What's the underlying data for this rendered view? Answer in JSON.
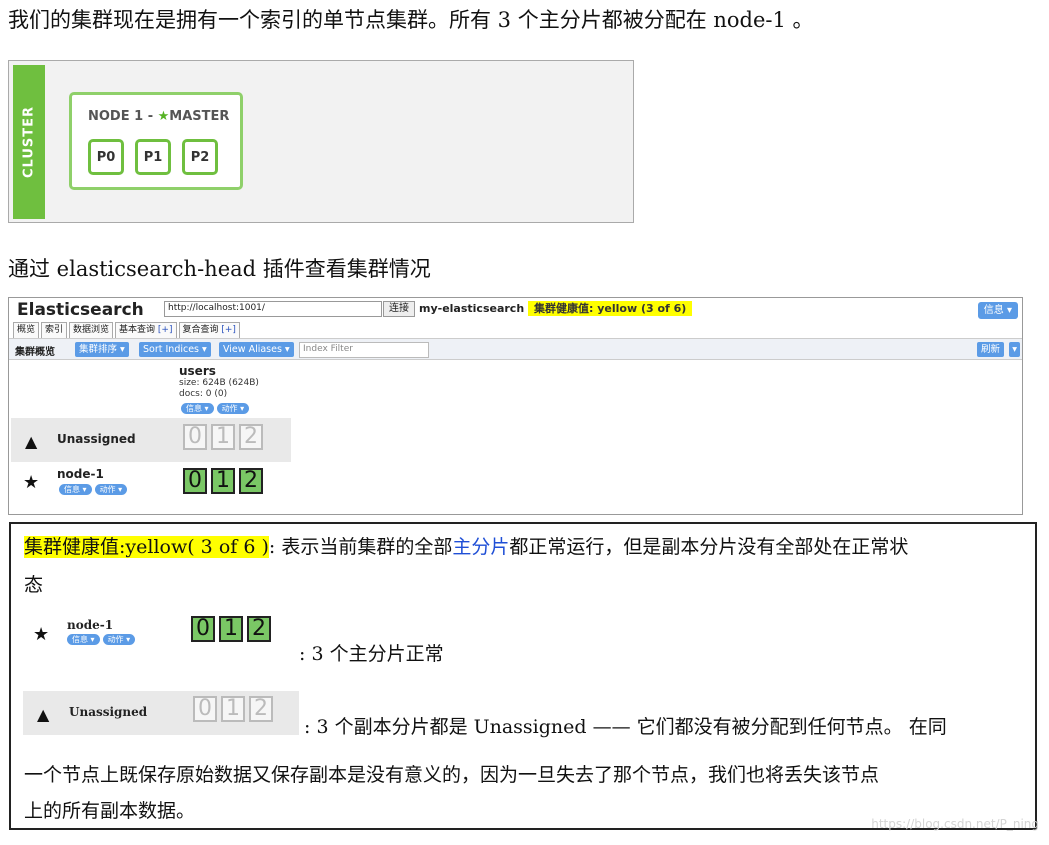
{
  "paragraphs": {
    "intro": "我们的集群现在是拥有一个索引的单节点集群。所有 3 个主分片都被分配在  node-1  。",
    "head_plugin": "通过 elasticsearch-head 插件查看集群情况"
  },
  "cluster_diagram": {
    "cluster_label": "CLUSTER",
    "node_title": "NODE 1 - ",
    "master_label": "MASTER",
    "shards": [
      "P0",
      "P1",
      "P2"
    ]
  },
  "es_head": {
    "logo": "Elasticsearch",
    "url": "http://localhost:1001/",
    "connect_label": "连接",
    "cluster_name": "my-elasticsearch",
    "health_text": "集群健康值: yellow (3 of 6)",
    "info_button": "信息 ▾",
    "tabs": [
      {
        "label": "概览",
        "plus": ""
      },
      {
        "label": "索引",
        "plus": ""
      },
      {
        "label": "数据浏览",
        "plus": ""
      },
      {
        "label": "基本查询 ",
        "plus": "[+]"
      },
      {
        "label": "复合查询 ",
        "plus": "[+]"
      }
    ],
    "toolbar_label": "集群概览",
    "sort_cluster_button": "集群排序 ▾",
    "sort_indices_button": "Sort Indices ▾",
    "view_aliases_button": "View Aliases ▾",
    "index_filter_placeholder": "Index Filter",
    "refresh_button": "刷新",
    "index": {
      "name": "users",
      "size": "size: 624B (624B)",
      "docs": "docs: 0 (0)",
      "info_pill": "信息 ▾",
      "action_pill": "动作 ▾"
    },
    "unassigned_label": "Unassigned",
    "node_name": "node-1",
    "node_info_pill": "信息 ▾",
    "node_action_pill": "动作 ▾",
    "replica_shards": [
      "0",
      "1",
      "2"
    ],
    "primary_shards": [
      "0",
      "1",
      "2"
    ]
  },
  "explanation": {
    "health_highlight": "集群健康值:yellow( 3 of 6 )",
    "line1_a": ": 表示当前集群的全部",
    "line1_blue": "主分片",
    "line1_b": "都正常运行，但是副本分片没有全部处在正常状",
    "line2": "态",
    "node_name": "node-1",
    "node_info_pill": "信息 ▾",
    "node_action_pill": "动作 ▾",
    "primary_shards": [
      "0",
      "1",
      "2"
    ],
    "caption_primary": ": 3 个主分片正常",
    "unassigned_label": "Unassigned",
    "replica_shards": [
      "0",
      "1",
      "2"
    ],
    "caption_replica": ": 3 个副本分片都是  Unassigned  ——  它们都没有被分配到任何节点。 在同",
    "line3": "一个节点上既保存原始数据又保存副本是没有意义的，因为一旦失去了那个节点，我们也将丢失该节点",
    "line4": "上的所有副本数据。"
  },
  "watermark": "https://blog.csdn.net/P_ning",
  "colors": {
    "green_accent": "#6fbf3f",
    "shard_green": "#7ac765",
    "button_blue": "#5b9be6",
    "health_yellow": "#ffff00",
    "link_blue": "#1f4fd6"
  }
}
